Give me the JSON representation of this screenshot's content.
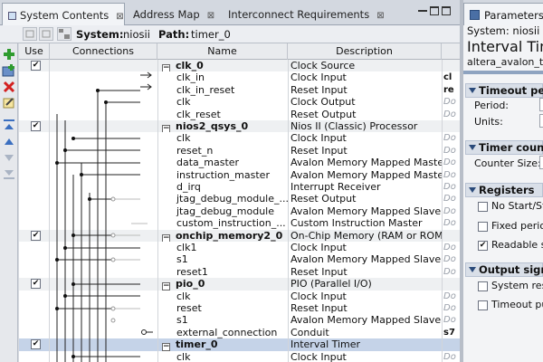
{
  "tabs": [
    {
      "label": "System Contents",
      "active": true
    },
    {
      "label": "Address Map",
      "active": false
    },
    {
      "label": "Interconnect Requirements",
      "active": false
    }
  ],
  "tab_close_glyph": "⊠",
  "path": {
    "system_label": "System:",
    "system_value": "niosii",
    "path_label": "Path:",
    "path_value": "timer_0"
  },
  "columns": {
    "use": "Use",
    "connections": "Connections",
    "name": "Name",
    "description": "Description"
  },
  "rows": [
    {
      "name": "clk_0",
      "desc": "Clock Source",
      "exp": "",
      "type": "system",
      "checked": true
    },
    {
      "name": "clk_in",
      "desc": "Clock Input",
      "exp": "cl",
      "exp_bold": true,
      "type": "pin"
    },
    {
      "name": "clk_in_reset",
      "desc": "Reset Input",
      "exp": "re",
      "exp_bold": true,
      "type": "pin"
    },
    {
      "name": "clk",
      "desc": "Clock Output",
      "exp": "Do",
      "type": "pin"
    },
    {
      "name": "clk_reset",
      "desc": "Reset Output",
      "exp": "Do",
      "type": "pin"
    },
    {
      "name": "nios2_qsys_0",
      "desc": "Nios II (Classic) Processor",
      "exp": "",
      "type": "system",
      "checked": true
    },
    {
      "name": "clk",
      "desc": "Clock Input",
      "exp": "Do",
      "type": "pin"
    },
    {
      "name": "reset_n",
      "desc": "Reset Input",
      "exp": "Do",
      "type": "pin"
    },
    {
      "name": "data_master",
      "desc": "Avalon Memory Mapped Master",
      "exp": "Do",
      "type": "pin"
    },
    {
      "name": "instruction_master",
      "desc": "Avalon Memory Mapped Master",
      "exp": "Do",
      "type": "pin"
    },
    {
      "name": "d_irq",
      "desc": "Interrupt Receiver",
      "exp": "Do",
      "type": "pin"
    },
    {
      "name": "jtag_debug_module_...",
      "desc": "Reset Output",
      "exp": "Do",
      "type": "pin"
    },
    {
      "name": "jtag_debug_module",
      "desc": "Avalon Memory Mapped Slave",
      "exp": "Do",
      "type": "pin"
    },
    {
      "name": "custom_instruction_...",
      "desc": "Custom Instruction Master",
      "exp": "Do",
      "type": "pin"
    },
    {
      "name": "onchip_memory2_0",
      "desc": "On-Chip Memory (RAM or ROM)",
      "exp": "",
      "type": "system",
      "checked": true
    },
    {
      "name": "clk1",
      "desc": "Clock Input",
      "exp": "Do",
      "type": "pin"
    },
    {
      "name": "s1",
      "desc": "Avalon Memory Mapped Slave",
      "exp": "Do",
      "type": "pin"
    },
    {
      "name": "reset1",
      "desc": "Reset Input",
      "exp": "Do",
      "type": "pin"
    },
    {
      "name": "pio_0",
      "desc": "PIO (Parallel I/O)",
      "exp": "",
      "type": "system",
      "checked": true
    },
    {
      "name": "clk",
      "desc": "Clock Input",
      "exp": "Do",
      "type": "pin"
    },
    {
      "name": "reset",
      "desc": "Reset Input",
      "exp": "Do",
      "type": "pin"
    },
    {
      "name": "s1",
      "desc": "Avalon Memory Mapped Slave",
      "exp": "Do",
      "type": "pin"
    },
    {
      "name": "external_connection",
      "desc": "Conduit",
      "exp": "s7",
      "exp_bold": true,
      "type": "pin"
    },
    {
      "name": "timer_0",
      "desc": "Interval Timer",
      "exp": "",
      "type": "system",
      "checked": true,
      "selected": true
    },
    {
      "name": "clk",
      "desc": "Clock Input",
      "exp": "Do",
      "type": "pin"
    }
  ],
  "params": {
    "tab_label": "Parameters",
    "system_line": "System: niosii",
    "title": "Interval Tim",
    "subtitle": "altera_avalon_tim",
    "sections": [
      {
        "label": "Timeout per",
        "fields": [
          "Period:",
          "Units:"
        ]
      },
      {
        "label": "Timer counte",
        "fields": [
          "Counter Size:"
        ]
      },
      {
        "label": "Registers",
        "checks": [
          {
            "label": "No Start/St",
            "checked": false
          },
          {
            "label": "Fixed perio",
            "checked": false
          },
          {
            "label": "Readable s",
            "checked": true
          }
        ]
      },
      {
        "label": "Output sign",
        "checks": [
          {
            "label": "System res",
            "checked": false
          },
          {
            "label": "Timeout pu",
            "checked": false
          }
        ]
      }
    ]
  },
  "colors": {
    "selected_row": "#c5d3e8",
    "accent": "#2a4a7a",
    "add_button": "#2e9b2e",
    "remove_button": "#d32020"
  }
}
